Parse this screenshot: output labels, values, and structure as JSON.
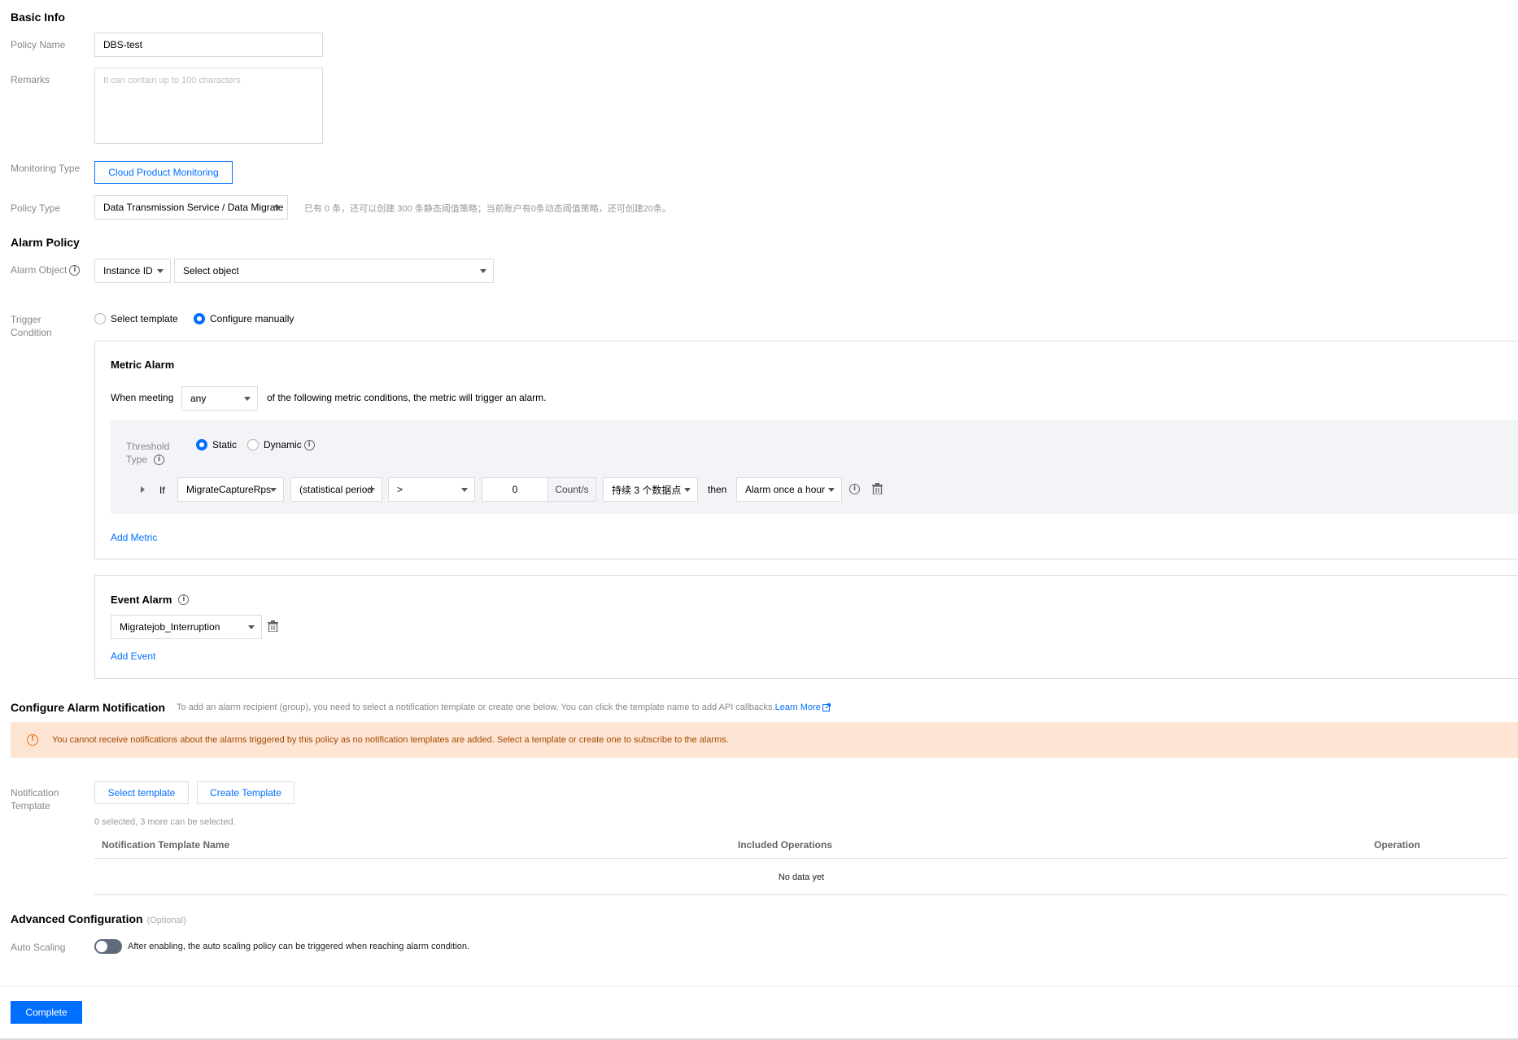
{
  "basic_info": {
    "title": "Basic Info",
    "policy_name_label": "Policy Name",
    "policy_name_value": "DBS-test",
    "remarks_label": "Remarks",
    "remarks_placeholder": "It can contain up to 100 characters",
    "monitoring_type_label": "Monitoring Type",
    "monitoring_type_value": "Cloud Product Monitoring",
    "policy_type_label": "Policy Type",
    "policy_type_value": "Data Transmission Service / Data Migrate",
    "policy_type_hint": "已有 0 条，还可以创建 300 条静态阈值策略；当前账户有0条动态阈值策略，还可创建20条。"
  },
  "alarm_policy": {
    "title": "Alarm Policy",
    "alarm_object_label": "Alarm Object",
    "alarm_object_type": "Instance ID",
    "alarm_object_select": "Select object",
    "trigger_condition_label_1": "Trigger",
    "trigger_condition_label_2": "Condition",
    "option_select_template": "Select template",
    "option_configure_manually": "Configure manually"
  },
  "metric_alarm": {
    "title": "Metric Alarm",
    "when_meeting": "When meeting",
    "match_mode": "any",
    "condition_suffix": "of the following metric conditions, the metric will trigger an alarm.",
    "threshold_type_label_1": "Threshold",
    "threshold_type_label_2": "Type",
    "threshold_static": "Static",
    "threshold_dynamic": "Dynamic",
    "if_label": "If",
    "metric": "MigrateCaptureRps",
    "period": "(statistical period",
    "operator": ">",
    "threshold_value": "0",
    "unit": "Count/s",
    "duration": "持续 3 个数据点",
    "then_label": "then",
    "frequency": "Alarm once a hour",
    "add_metric": "Add Metric"
  },
  "event_alarm": {
    "title": "Event Alarm",
    "event": "Migratejob_Interruption",
    "add_event": "Add Event"
  },
  "notification": {
    "title": "Configure Alarm Notification",
    "description": "To add an alarm recipient (group), you need to select a notification template or create one below. You can click the template name to add API callbacks.",
    "learn_more": "Learn More",
    "warning": "You cannot receive notifications about the alarms triggered by this policy as no notification templates are added. Select a template or create one to subscribe to the alarms.",
    "template_label_1": "Notification",
    "template_label_2": "Template",
    "select_template_btn": "Select template",
    "create_template_btn": "Create Template",
    "selection_hint": "0 selected, 3 more can be selected.",
    "columns": [
      "Notification Template Name",
      "Included Operations",
      "Operation"
    ],
    "empty_text": "No data yet"
  },
  "advanced": {
    "title": "Advanced Configuration",
    "optional": "(Optional)",
    "auto_scaling_label": "Auto Scaling",
    "auto_scaling_desc": "After enabling, the auto scaling policy can be triggered when reaching alarm condition.",
    "auto_scaling_enabled": false
  },
  "footer": {
    "complete_btn": "Complete"
  },
  "colors": {
    "accent": "#006eff",
    "warning_bg": "#fde4d3",
    "warning_icon": "#e37318",
    "threshold_bg": "#f3f4f7"
  }
}
